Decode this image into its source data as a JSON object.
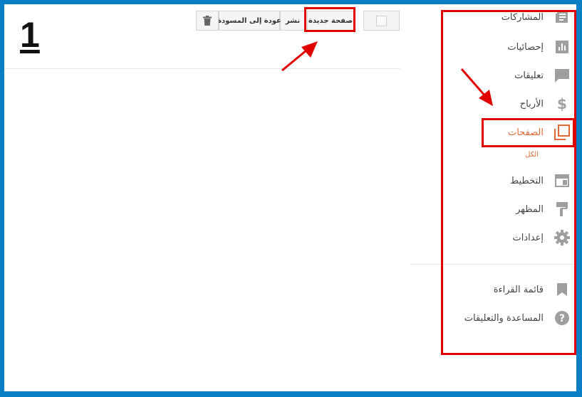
{
  "step_number": "1",
  "toolbar": {
    "new_page_label": "صفحة جديدة",
    "publish_label": "نشر",
    "revert_label": "عودة إلى المسودة"
  },
  "sidebar": {
    "items": [
      {
        "label": "المشاركات",
        "icon": "posts-icon"
      },
      {
        "label": "إحصائيات",
        "icon": "stats-icon"
      },
      {
        "label": "تعليقات",
        "icon": "comments-icon"
      },
      {
        "label": "الأرباح",
        "icon": "dollar-icon"
      },
      {
        "label": "الصفحات",
        "icon": "pages-icon",
        "active": true
      },
      {
        "label": "التخطيط",
        "icon": "layout-icon"
      },
      {
        "label": "المظهر",
        "icon": "paint-roller-icon"
      },
      {
        "label": "إعدادات",
        "icon": "gear-icon"
      }
    ],
    "pages_sub_label": "الكل",
    "bottom_items": [
      {
        "label": "قائمة القراءة",
        "icon": "bookmark-icon"
      },
      {
        "label": "المساعدة والتعليقات",
        "icon": "help-icon"
      }
    ]
  },
  "colors": {
    "frame": "#0a7fc6",
    "accent": "#e06a37",
    "highlight": "#e00000",
    "icon": "#9e9e9e"
  }
}
